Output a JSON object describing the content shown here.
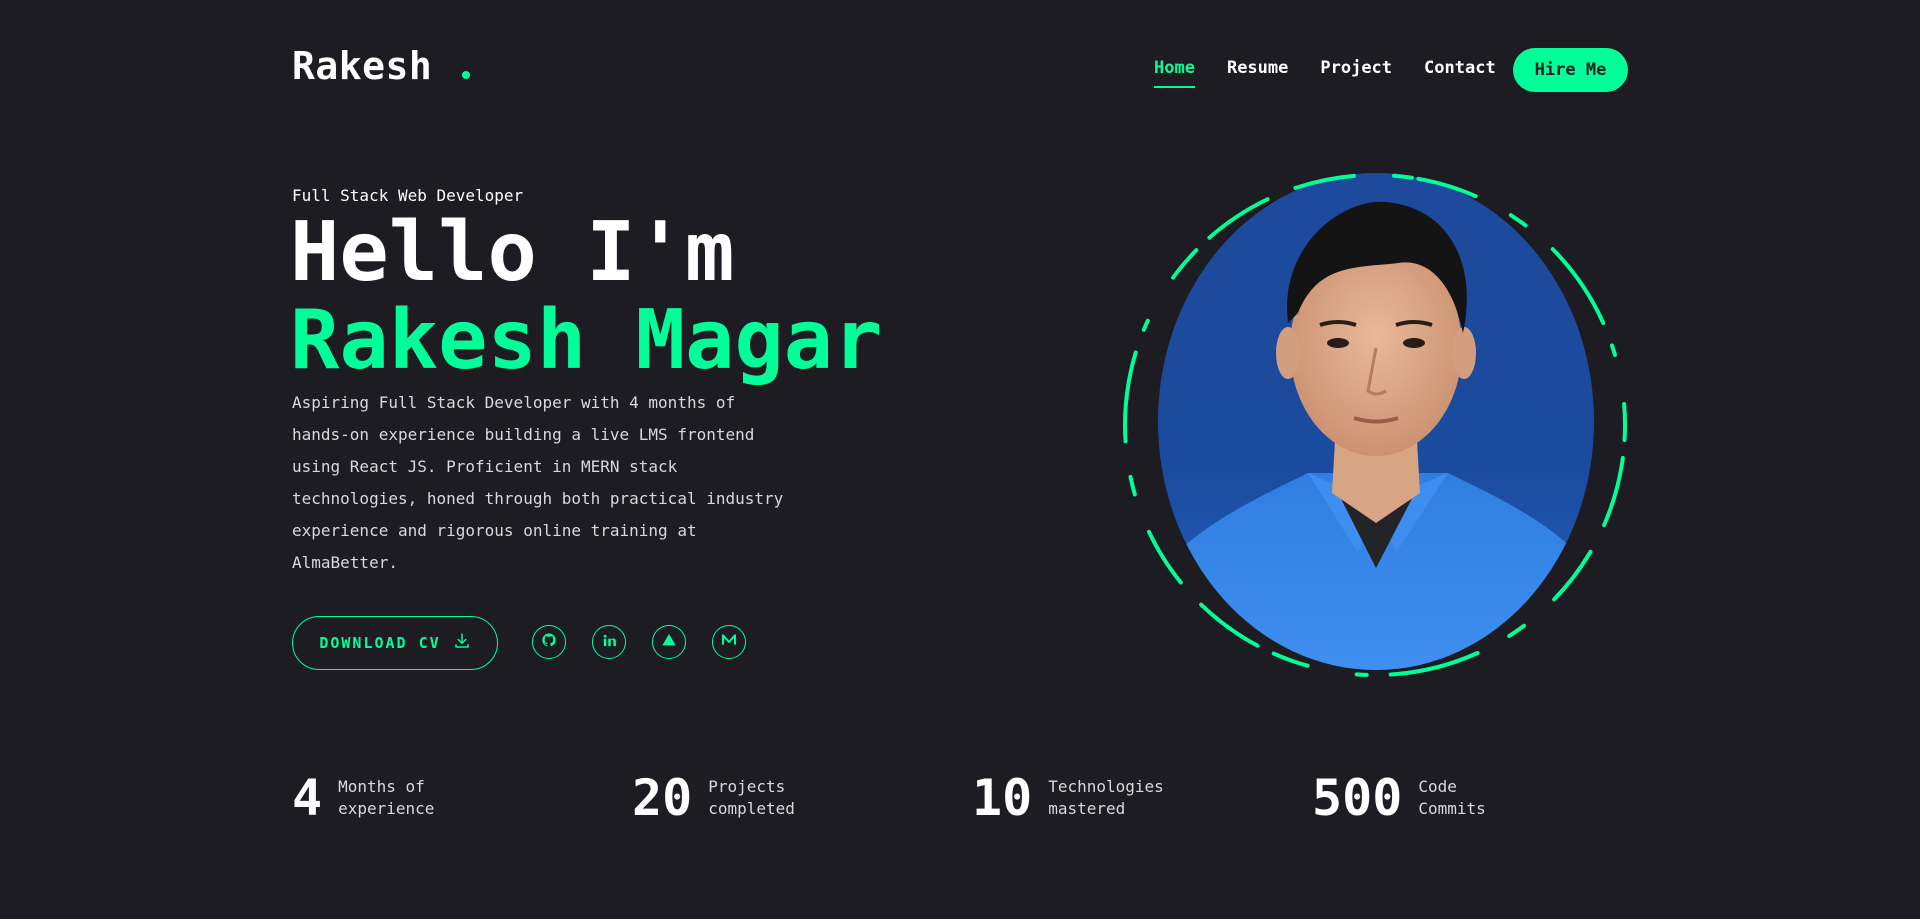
{
  "logo": {
    "text": "Rakesh"
  },
  "nav": {
    "items": [
      "Home",
      "Resume",
      "Project",
      "Contact"
    ],
    "active": "Home",
    "hire_label": "Hire Me"
  },
  "hero": {
    "role": "Full Stack Web Developer",
    "greeting": "Hello I'm",
    "name": "Rakesh Magar",
    "description": "Aspiring Full Stack Developer with 4 months of hands-on experience building a live LMS frontend using React JS. Proficient in MERN stack technologies, honed through both practical industry experience and rigorous online training at AlmaBetter.",
    "cv_label": "DOWNLOAD CV",
    "socials": [
      "github-icon",
      "linkedin-icon",
      "triangle-icon",
      "medium-icon"
    ]
  },
  "stats": [
    {
      "value": "4",
      "label_line1": "Months of",
      "label_line2": "experience"
    },
    {
      "value": "20",
      "label_line1": "Projects",
      "label_line2": "completed"
    },
    {
      "value": "10",
      "label_line1": "Technologies",
      "label_line2": "mastered"
    },
    {
      "value": "500",
      "label_line1": "Code",
      "label_line2": "Commits"
    }
  ],
  "colors": {
    "accent": "#00ff99",
    "background": "#1c1c22",
    "text": "#ffffff"
  }
}
